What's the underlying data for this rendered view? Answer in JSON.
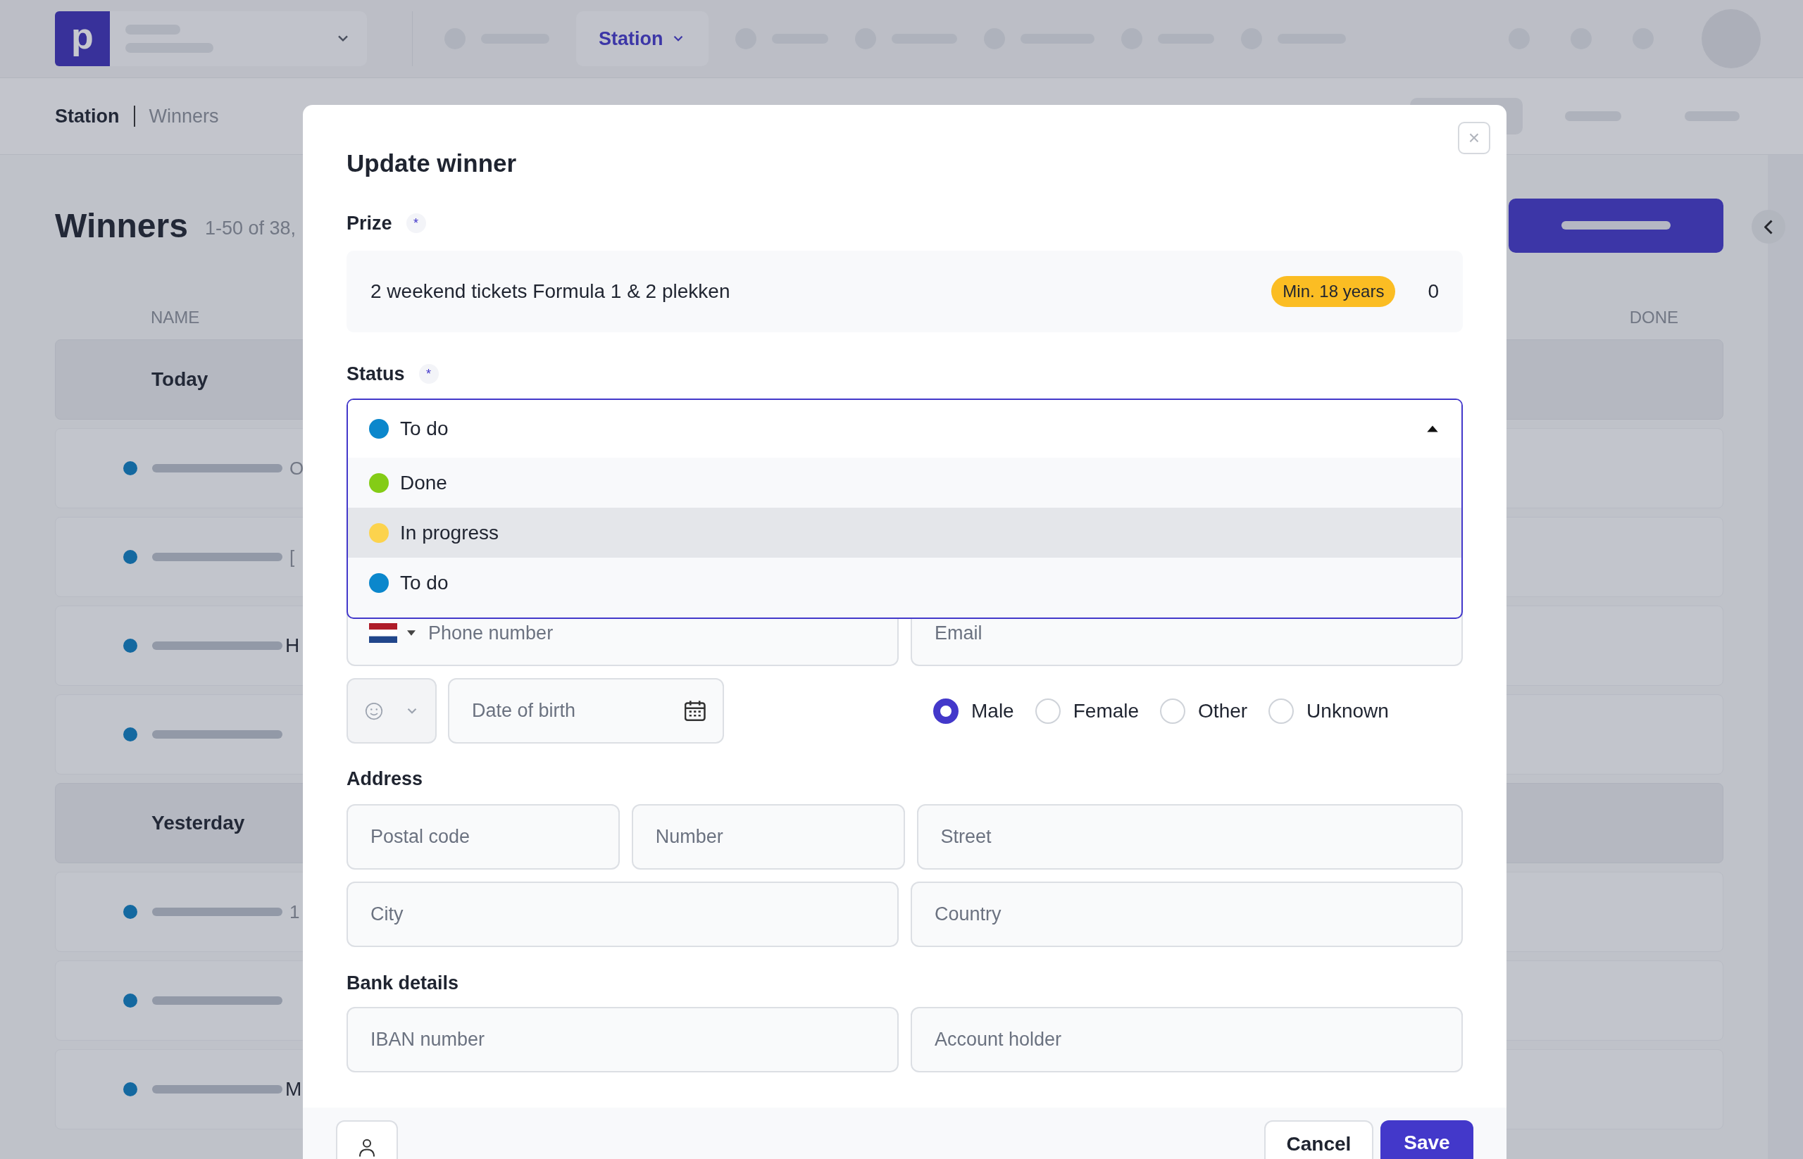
{
  "top_bar": {
    "logo": "p",
    "active_nav": "Station"
  },
  "breadcrumb": [
    "Station",
    "Winners"
  ],
  "page": {
    "title": "Winners",
    "count": "1-50 of 38,"
  },
  "table": {
    "columns": [
      "NAME",
      "DONE"
    ],
    "groups": [
      {
        "label": "Today",
        "rows": [
          {
            "text": "O",
            "strong": false
          },
          {
            "text": "[",
            "strong": false
          },
          {
            "text": "H",
            "strong": true
          },
          {}
        ]
      },
      {
        "label": "Yesterday",
        "rows": [
          {
            "text": "1",
            "strong": false
          },
          {},
          {
            "text": "M",
            "strong": true
          }
        ]
      }
    ]
  },
  "modal": {
    "title": "Update winner",
    "close": "×",
    "prize": {
      "label": "Prize",
      "required": "*",
      "name": "2 weekend tickets Formula 1 & 2 plekken",
      "badge": "Min. 18 years",
      "count": "0"
    },
    "status": {
      "label": "Status",
      "required": "*",
      "value": "To do",
      "color": "#0b87cc",
      "expanded": true,
      "options": [
        {
          "label": "Done",
          "color": "#84cc16",
          "hovered": false
        },
        {
          "label": "In progress",
          "color": "#fcd34d",
          "hovered": true
        },
        {
          "label": "To do",
          "color": "#0b87cc",
          "hovered": false
        }
      ]
    },
    "phone": {
      "placeholder": "Phone number"
    },
    "email": {
      "placeholder": "Email"
    },
    "birth": {
      "placeholder": "Date of birth"
    },
    "gender": [
      {
        "label": "Male",
        "selected": true
      },
      {
        "label": "Female",
        "selected": false
      },
      {
        "label": "Other",
        "selected": false
      },
      {
        "label": "Unknown",
        "selected": false
      }
    ],
    "address": {
      "label": "Address",
      "fields": [
        {
          "placeholder": "Postal code"
        },
        {
          "placeholder": "Number"
        },
        {
          "placeholder": "Street"
        },
        {
          "placeholder": "City"
        },
        {
          "placeholder": "Country"
        }
      ]
    },
    "bank": {
      "label": "Bank details",
      "fields": [
        {
          "placeholder": "IBAN number"
        },
        {
          "placeholder": "Account holder"
        }
      ]
    },
    "footer": {
      "cancel": "Cancel",
      "save": "Save"
    }
  }
}
